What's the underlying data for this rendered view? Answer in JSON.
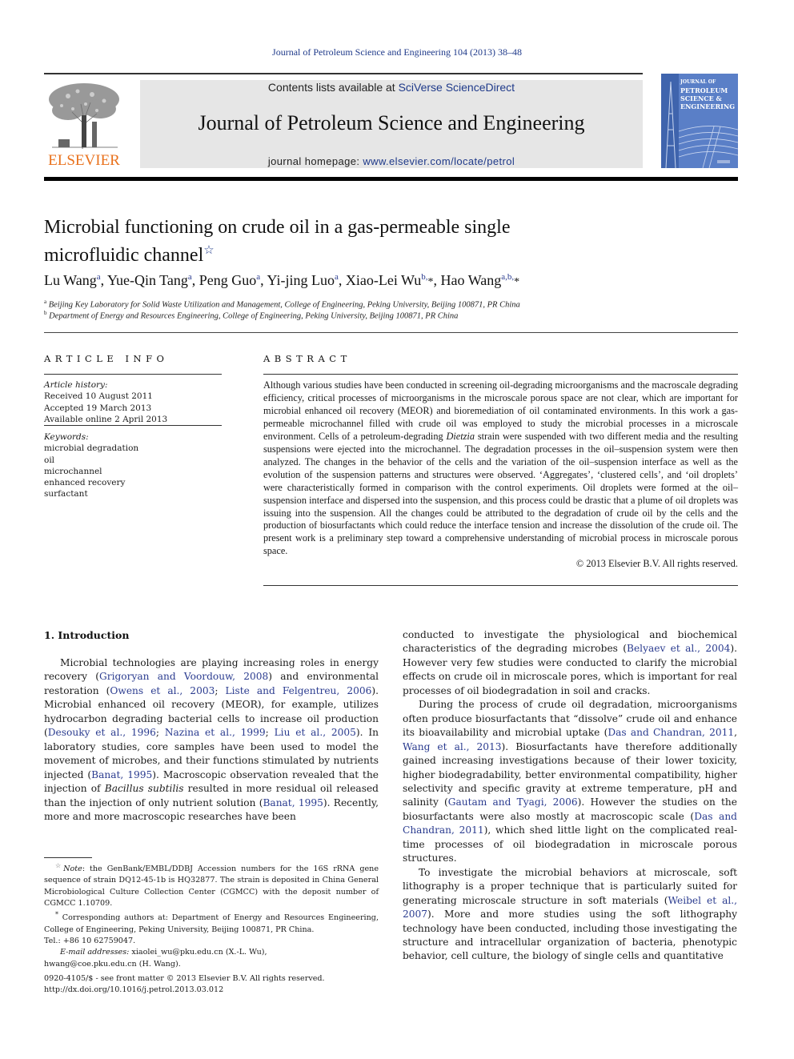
{
  "header": {
    "journal_reference": "Journal of Petroleum Science and Engineering 104 (2013) 38–48",
    "contents_prefix": "Contents lists available at ",
    "contents_link": "SciVerse ScienceDirect",
    "journal_name": "Journal of Petroleum Science and Engineering",
    "homepage_prefix": "journal homepage: ",
    "homepage_link": "www.elsevier.com/locate/petrol",
    "publisher_wordmark": "ELSEVIER",
    "publisher_color": "#e9711c",
    "cover": {
      "line1": "JOURNAL OF",
      "line2": "PETROLEUM",
      "line3": "SCIENCE &",
      "line4": "ENGINEERING",
      "color": "#5a7fc7"
    }
  },
  "article": {
    "title_line1": "Microbial functioning on crude oil in a gas-permeable single",
    "title_line2": "microfluidic channel",
    "title_note_symbol": "☆",
    "authors": [
      {
        "name": "Lu Wang",
        "sup": "a",
        "sep": ", "
      },
      {
        "name": "Yue-Qin Tang",
        "sup": "a",
        "sep": ", "
      },
      {
        "name": "Peng Guo",
        "sup": "a",
        "sep": ", "
      },
      {
        "name": "Yi-jing Luo",
        "sup": "a",
        "sep": ", "
      },
      {
        "name": "Xiao-Lei Wu",
        "sup": "b,",
        "star": "*",
        "sep": ", "
      },
      {
        "name": "Hao Wang",
        "sup": "a,b,",
        "star": "*",
        "sep": ""
      }
    ],
    "affiliations": [
      {
        "key": "a",
        "text": "Beijing Key Laboratory for Solid Waste Utilization and Management, College of Engineering, Peking University, Beijing 100871, PR China"
      },
      {
        "key": "b",
        "text": "Department of Energy and Resources Engineering, College of Engineering, Peking University, Beijing 100871, PR China"
      }
    ]
  },
  "article_info": {
    "heading": "ARTICLE INFO",
    "history_label": "Article history:",
    "received": "Received 10 August 2011",
    "accepted": "Accepted 19 March 2013",
    "available": "Available online 2 April 2013",
    "keywords_label": "Keywords:",
    "keywords": [
      "microbial degradation",
      "oil",
      "microchannel",
      "enhanced recovery",
      "surfactant"
    ]
  },
  "abstract": {
    "heading": "ABSTRACT",
    "part1": "Although various studies have been conducted in screening oil-degrading microorganisms and the macroscale degrading efficiency, critical processes of microorganisms in the microscale porous space are not clear, which are important for microbial enhanced oil recovery (MEOR) and bioremediation of oil contaminated environments. In this work a gas-permeable microchannel filled with crude oil was employed to study the microbial processes in a microscale environment. Cells of a petroleum-degrading ",
    "italic_term": "Dietzia",
    "part2": " strain were suspended with two different media and the resulting suspensions were ejected into the microchannel. The degradation processes in the oil–suspension system were then analyzed. The changes in the behavior of the cells and the variation of the oil–suspension interface as well as the evolution of the suspension patterns and structures were observed. ‘Aggregates’, ‘clustered cells’, and ‘oil droplets’ were characteristically formed in comparison with the control experiments. Oil droplets were formed at the oil–suspension interface and dispersed into the suspension, and this process could be drastic that a plume of oil droplets was issuing into the suspension. All the changes could be attributed to the degradation of crude oil by the cells and the production of biosurfactants which could reduce the interface tension and increase the dissolution of the crude oil. The present work is a preliminary step toward a comprehensive understanding of microbial process in microscale porous space.",
    "copyright": "© 2013 Elsevier B.V. All rights reserved."
  },
  "introduction": {
    "heading": "1.  Introduction",
    "left": {
      "s1": "Microbial technologies are playing increasing roles in energy recovery (",
      "c1": "Grigoryan and Voordouw, 2008",
      "s2": ") and environmental restoration (",
      "c2": "Owens et al., 2003",
      "s3": "; ",
      "c3": "Liste and Felgentreu, 2006",
      "s4": "). Microbial enhanced oil recovery (MEOR), for example, utilizes hydrocarbon degrading bacterial cells to increase oil production (",
      "c4": "Desouky et al., 1996",
      "s5": "; ",
      "c5": "Nazina et al., 1999",
      "s6": "; ",
      "c6": "Liu et al., 2005",
      "s7": "). In laboratory studies, core samples have been used to model the movement of microbes, and their functions stimulated by nutrients injected (",
      "c7": "Banat, 1995",
      "s8": "). Macroscopic observation revealed that the injection of ",
      "italic1": "Bacillus subtilis",
      "s9": " resulted in more residual oil released than the injection of only nutrient solution (",
      "c8": "Banat, 1995",
      "s10": "). Recently, more and more macroscopic researches have been"
    },
    "right": {
      "p1_s1": "conducted to investigate the physiological and biochemical characteristics of the degrading microbes (",
      "p1_c1": "Belyaev et al., 2004",
      "p1_s2": "). However very few studies were conducted to clarify the microbial effects on crude oil in microscale pores, which is important for real processes of oil biodegradation in soil and cracks.",
      "p2_s1": "During the process of crude oil degradation, microorganisms often produce biosurfactants that “dissolve” crude oil and enhance its bioavailability and microbial uptake (",
      "p2_c1": "Das and Chandran, 2011",
      "p2_s2": ", ",
      "p2_c2": "Wang et al., 2013",
      "p2_s3": "). Biosurfactants have therefore additionally gained increasing investigations because of their lower toxicity, higher biodegradability, better environmental compatibility, higher selectivity and specific gravity at extreme temperature, pH and salinity (",
      "p2_c3": "Gautam and Tyagi, 2006",
      "p2_s4": "). However the studies on the biosurfactants were also mostly at macroscopic scale (",
      "p2_c4": "Das and Chandran, 2011",
      "p2_s5": "), which shed little light on the complicated real-time processes of oil biodegradation in microscale porous structures.",
      "p3_s1": "To investigate the microbial behaviors at microscale, soft lithography is a proper technique that is particularly suited for generating microscale structure in soft materials (",
      "p3_c1": "Weibel et al., 2007",
      "p3_s2": "). More and more studies using the soft lithography technology have been conducted, including those investigating the structure and intracellular organization of bacteria, phenotypic behavior, cell culture, the biology of single cells and quantitative"
    }
  },
  "footnotes": {
    "note_symbol": "☆",
    "note_label": "Note",
    "note_text": ": the GenBank/EMBL/DDBJ Accession numbers for the 16S rRNA gene sequence of strain DQ12-45-1b is HQ32877. The strain is deposited in China General Microbiological Culture Collection Center (CGMCC) with the deposit number of CGMCC 1.10709.",
    "corr_symbol": "*",
    "corr_text": " Corresponding authors at: Department of Energy and Resources Engineering, College of Engineering, Peking University, Beijing 100871, PR China.",
    "tel": "Tel.: +86 10 62759047.",
    "email_label": "E-mail addresses:",
    "email1": " xiaolei_wu@pku.edu.cn (X.-L. Wu),",
    "email2": "hwang@coe.pku.edu.cn (H. Wang)."
  },
  "front_matter": {
    "issn_line": "0920-4105/$ - see front matter © 2013 Elsevier B.V. All rights reserved.",
    "doi": "http://dx.doi.org/10.1016/j.petrol.2013.03.012"
  }
}
